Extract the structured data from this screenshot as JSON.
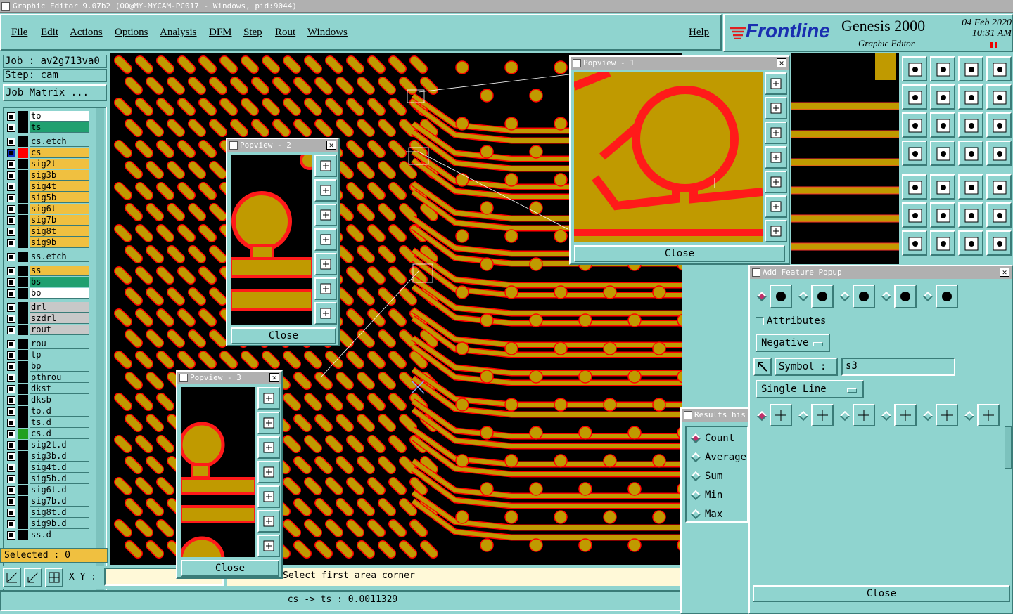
{
  "window": {
    "title": "Graphic Editor 9.07b2 (OO@MY-MYCAM-PC017 - Windows, pid:9044)"
  },
  "menu": [
    "File",
    "Edit",
    "Actions",
    "Options",
    "Analysis",
    "DFM",
    "Step",
    "Rout",
    "Windows"
  ],
  "help_label": "Help",
  "brand": {
    "logo": "Frontline",
    "product": "Genesis 2000",
    "subtitle": "Graphic Editor",
    "date": "04 Feb 2020",
    "time": "10:31 AM"
  },
  "job": {
    "job_line": "Job : av2g713va0",
    "step_line": "Step: cam",
    "matrix_button": "Job Matrix ..."
  },
  "layers": [
    {
      "name": "to",
      "color": "#ffffff",
      "swatch": "#000000"
    },
    {
      "name": "ts",
      "color": "#20a070",
      "swatch": "#000000"
    },
    {
      "name": "cs.etch",
      "color": "#8fd4cf",
      "swatch": "#000000"
    },
    {
      "name": "cs",
      "color": "#f0c040",
      "swatch": "#ff0000",
      "active": true
    },
    {
      "name": "sig2t",
      "color": "#f0c040",
      "swatch": "#000000"
    },
    {
      "name": "sig3b",
      "color": "#f0c040",
      "swatch": "#000000"
    },
    {
      "name": "sig4t",
      "color": "#f0c040",
      "swatch": "#000000"
    },
    {
      "name": "sig5b",
      "color": "#f0c040",
      "swatch": "#000000"
    },
    {
      "name": "sig6t",
      "color": "#f0c040",
      "swatch": "#000000"
    },
    {
      "name": "sig7b",
      "color": "#f0c040",
      "swatch": "#000000"
    },
    {
      "name": "sig8t",
      "color": "#f0c040",
      "swatch": "#000000"
    },
    {
      "name": "sig9b",
      "color": "#f0c040",
      "swatch": "#000000"
    },
    {
      "name": "ss.etch",
      "color": "#8fd4cf",
      "swatch": "#000000"
    },
    {
      "name": "ss",
      "color": "#f0c040",
      "swatch": "#000000"
    },
    {
      "name": "bs",
      "color": "#20a070",
      "swatch": "#000000"
    },
    {
      "name": "bo",
      "color": "#ffffff",
      "swatch": "#000000"
    },
    {
      "name": "drl",
      "color": "#c8c8c8",
      "swatch": "#000000"
    },
    {
      "name": "szdrl",
      "color": "#c8c8c8",
      "swatch": "#000000"
    },
    {
      "name": "rout",
      "color": "#c8c8c8",
      "swatch": "#000000"
    },
    {
      "name": "rou",
      "color": "#8fd4cf",
      "swatch": "#000000"
    },
    {
      "name": "tp",
      "color": "#8fd4cf",
      "swatch": "#000000"
    },
    {
      "name": "bp",
      "color": "#8fd4cf",
      "swatch": "#000000"
    },
    {
      "name": "pthrou",
      "color": "#8fd4cf",
      "swatch": "#000000"
    },
    {
      "name": "dkst",
      "color": "#8fd4cf",
      "swatch": "#000000"
    },
    {
      "name": "dksb",
      "color": "#8fd4cf",
      "swatch": "#000000"
    },
    {
      "name": "to.d",
      "color": "#8fd4cf",
      "swatch": "#000000"
    },
    {
      "name": "ts.d",
      "color": "#8fd4cf",
      "swatch": "#000000"
    },
    {
      "name": "cs.d",
      "color": "#8fd4cf",
      "swatch": "#20a020"
    },
    {
      "name": "sig2t.d",
      "color": "#8fd4cf",
      "swatch": "#000000"
    },
    {
      "name": "sig3b.d",
      "color": "#8fd4cf",
      "swatch": "#000000"
    },
    {
      "name": "sig4t.d",
      "color": "#8fd4cf",
      "swatch": "#000000"
    },
    {
      "name": "sig5b.d",
      "color": "#8fd4cf",
      "swatch": "#000000"
    },
    {
      "name": "sig6t.d",
      "color": "#8fd4cf",
      "swatch": "#000000"
    },
    {
      "name": "sig7b.d",
      "color": "#8fd4cf",
      "swatch": "#000000"
    },
    {
      "name": "sig8t.d",
      "color": "#8fd4cf",
      "swatch": "#000000"
    },
    {
      "name": "sig9b.d",
      "color": "#8fd4cf",
      "swatch": "#000000"
    },
    {
      "name": "ss.d",
      "color": "#8fd4cf",
      "swatch": "#000000"
    }
  ],
  "selected_label": "Selected : 0",
  "xy_label": "X Y :",
  "prompt": "Select first area corner",
  "measure": "cs -> ts : 0.0011329",
  "popviews": [
    {
      "title": "Popview - 1",
      "close": "Close"
    },
    {
      "title": "Popview - 2",
      "close": "Close"
    },
    {
      "title": "Popview - 3",
      "close": "Close"
    }
  ],
  "add_feature": {
    "title": "Add Feature Popup",
    "attributes_label": "Attributes",
    "polarity": "Negative",
    "symbol_label": "Symbol :",
    "symbol_value": "s3",
    "mode": "Single Line",
    "close": "Close"
  },
  "results": {
    "title": "Results his",
    "options": [
      "Count",
      "Average",
      "Sum",
      "Min",
      "Max"
    ]
  },
  "colors": {
    "copper": "#c09a00",
    "clearance": "#ff0000",
    "panel": "#8fd4cf",
    "canvas": "#000000"
  }
}
